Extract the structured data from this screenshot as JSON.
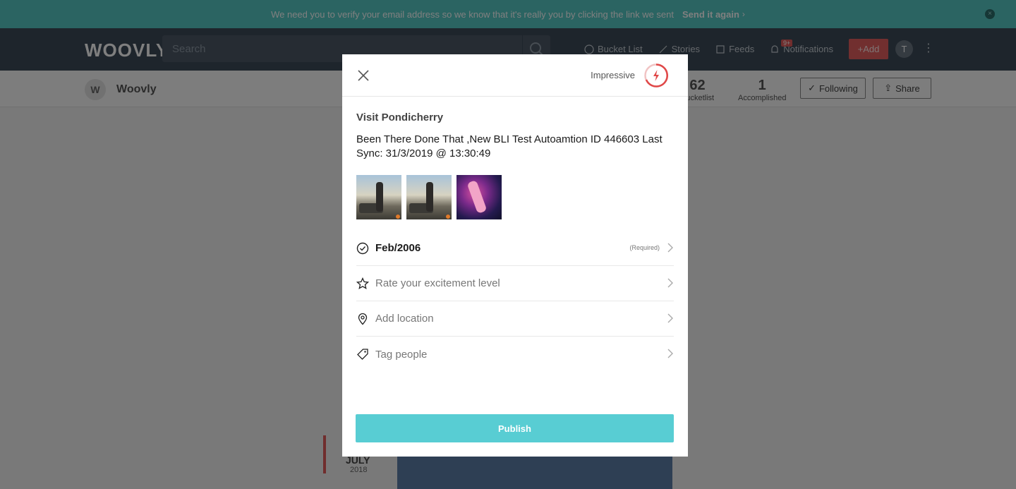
{
  "banner": {
    "message": "We need you to verify your email address so we know that it's really you by clicking the link we sent",
    "resend": "Send it again"
  },
  "nav": {
    "logo": "WOOVLY",
    "search_placeholder": "Search",
    "links": [
      "Bucket List",
      "Stories",
      "Feeds",
      "Notifications"
    ],
    "notification_badge": "9+",
    "add_label": "Add",
    "avatar_initial": "T"
  },
  "profile": {
    "initial": "W",
    "name": "Woovly",
    "bucketlist_count": "62",
    "bucketlist_label": "Bucketlist",
    "accomplished_count": "1",
    "accomplished_label": "Accomplished",
    "following_label": "Following",
    "share_label": "Share"
  },
  "timeline": {
    "month": "JULY",
    "year": "2018"
  },
  "modal": {
    "rating_label": "Impressive",
    "title": "Visit Pondicherry",
    "description": "Been There Done That ,New BLI Test  Autoamtion ID 446603 Last Sync: 31/3/2019 @ 13:30:49",
    "date": "Feb/2006",
    "date_required": "(Required)",
    "excitement": "Rate your excitement level",
    "location": "Add location",
    "tag": "Tag people",
    "publish": "Publish"
  },
  "colors": {
    "banner": "#56c8c5",
    "nav": "#3d4a58",
    "accent_red": "#e35f5f",
    "publish": "#58cdd3"
  }
}
